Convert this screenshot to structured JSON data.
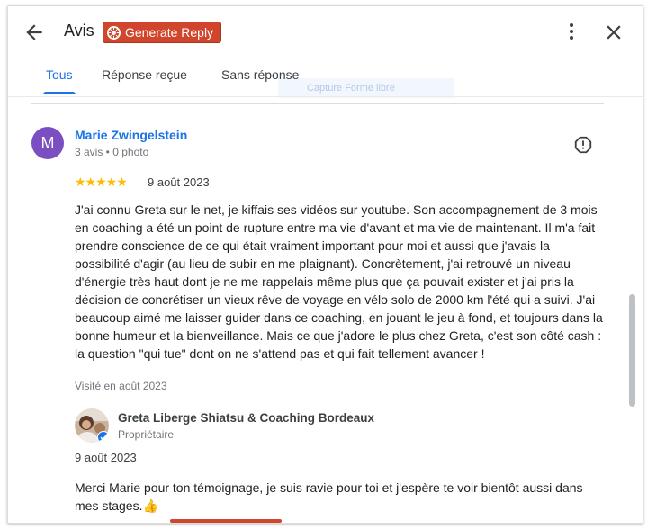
{
  "header": {
    "title": "Avis",
    "generate_reply_label": "Generate Reply",
    "icons": {
      "back": "arrow-left-icon",
      "more": "more-vert-icon",
      "close": "close-icon",
      "generate": "extension-logo-icon"
    }
  },
  "tabs": [
    {
      "label": "Tous",
      "active": true
    },
    {
      "label": "Réponse reçue",
      "active": false
    },
    {
      "label": "Sans réponse",
      "active": false
    }
  ],
  "ghost_overlay": "Capture Forme libre",
  "review": {
    "avatar_letter": "M",
    "avatar_color": "#7b4fc1",
    "name": "Marie Zwingelstein",
    "meta": "3 avis • 0 photo",
    "rating": 5,
    "stars": "★★★★★",
    "date": "9 août 2023",
    "text": "J'ai connu Greta sur le net, je kiffais ses vidéos sur youtube. Son accompagnement de 3 mois en coaching a été un point de rupture entre ma vie d'avant et ma vie de maintenant. Il m'a fait prendre conscience de ce qui était vraiment important pour moi et aussi que j'avais la possibilité d'agir (au lieu de subir en me plaignant). Concrètement, j'ai retrouvé un niveau d'énergie très haut dont je ne me rappelais même plus que ça pouvait exister et j'ai pris la décision de concrétiser un vieux rêve de voyage en vélo solo de 2000 km l'été qui a suivi. J'ai beaucoup aimé me laisser guider dans ce coaching, en jouant le jeu à fond, et toujours dans la bonne humeur et la bienveillance. Mais ce que j'adore le plus chez Greta, c'est son côté cash : la question \"qui tue\" dont on ne s'attend pas et qui fait tellement avancer !",
    "visited": "Visité en août 2023"
  },
  "owner_reply": {
    "name": "Greta Liberge Shiatsu & Coaching Bordeaux",
    "role": "Propriétaire",
    "date": "9 août 2023",
    "text": "Merci Marie pour ton témoignage, je suis ravie pour toi et j'espère te voir bientôt aussi dans mes stages.👍"
  },
  "colors": {
    "accent": "#1a73e8",
    "generate_button": "#d0452b",
    "star": "#fbbc04",
    "verified": "#1a73e8"
  }
}
